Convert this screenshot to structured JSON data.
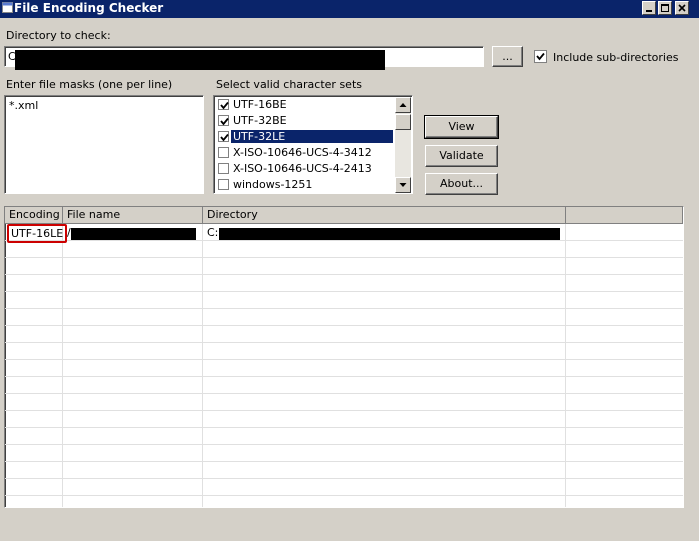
{
  "window": {
    "title": "File Encoding Checker",
    "buttons": [
      "minimize-button",
      "maximize-button",
      "close-button"
    ]
  },
  "directory": {
    "label": "Directory to check:",
    "value": "C",
    "browse_label": "...",
    "include_subdirs_label": "Include sub-directories",
    "include_subdirs_checked": true
  },
  "masks": {
    "label": "Enter file masks (one per line)",
    "value": "*.xml"
  },
  "charsets": {
    "label": "Select valid character sets",
    "items": [
      {
        "label": "UTF-16BE",
        "checked": true,
        "selected": false
      },
      {
        "label": "UTF-32BE",
        "checked": true,
        "selected": false
      },
      {
        "label": "UTF-32LE",
        "checked": true,
        "selected": true
      },
      {
        "label": "X-ISO-10646-UCS-4-3412",
        "checked": false,
        "selected": false
      },
      {
        "label": "X-ISO-10646-UCS-4-2413",
        "checked": false,
        "selected": false
      },
      {
        "label": "windows-1251",
        "checked": false,
        "selected": false
      }
    ]
  },
  "actions": {
    "view_label": "View",
    "validate_label": "Validate",
    "about_label": "About..."
  },
  "results": {
    "columns": [
      "Encoding",
      "File name",
      "Directory"
    ],
    "rows": [
      {
        "encoding": "UTF-16LE",
        "file_name": "/",
        "directory": "C:"
      }
    ]
  },
  "colors": {
    "titlebar": "#0a246a",
    "face": "#d4d0c8",
    "selection": "#0a246a",
    "highlight_box": "#cc0000"
  }
}
